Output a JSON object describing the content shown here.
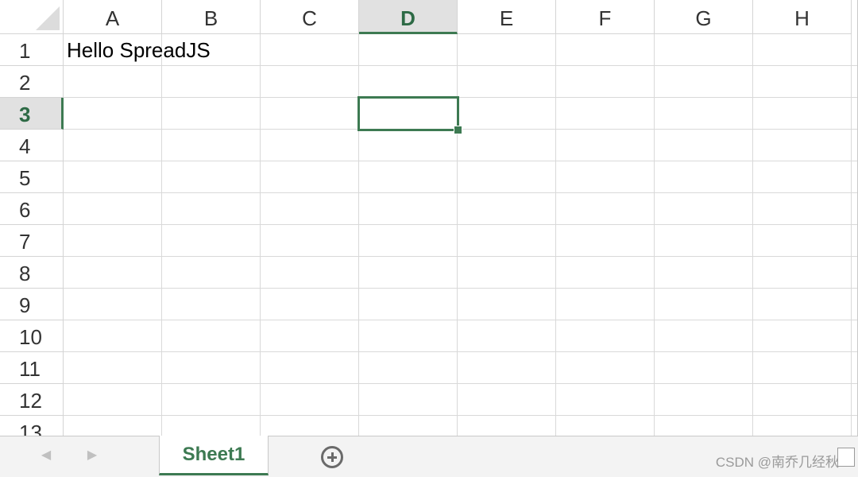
{
  "columns": [
    "A",
    "B",
    "C",
    "D",
    "E",
    "F",
    "G",
    "H"
  ],
  "rows": [
    "1",
    "2",
    "3",
    "4",
    "5",
    "6",
    "7",
    "8",
    "9",
    "10",
    "11",
    "12",
    "13"
  ],
  "active_column": "D",
  "active_row": "3",
  "cells": {
    "A1": "Hello SpreadJS"
  },
  "tabs": {
    "sheet1": "Sheet1"
  },
  "nav": {
    "prev": "◀",
    "next": "▶"
  },
  "watermark": "CSDN @南乔几经秋",
  "colors": {
    "accent": "#3d7a52",
    "header_active_bg": "#e1e1e1",
    "gridline": "#d9d9d9"
  },
  "icons": {
    "add_sheet": "plus-circle-icon",
    "prev": "arrow-left-icon",
    "next": "arrow-right-icon"
  }
}
